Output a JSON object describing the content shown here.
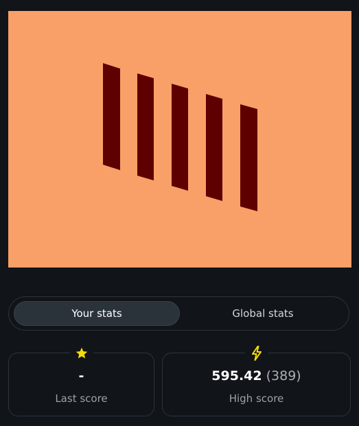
{
  "game": {
    "background_color": "#f8a067",
    "bar_color": "#5e0000",
    "bar_count": 5
  },
  "tabs": {
    "your_stats": "Your stats",
    "global_stats": "Global stats",
    "active": "your_stats"
  },
  "stats": {
    "last_score": {
      "icon": "star-icon",
      "value": "-",
      "label": "Last score"
    },
    "high_score": {
      "icon": "lightning-icon",
      "value": "595.42",
      "secondary": "(389)",
      "label": "High score"
    }
  },
  "colors": {
    "icon_yellow": "#f5d90a",
    "page_background": "#111418"
  }
}
